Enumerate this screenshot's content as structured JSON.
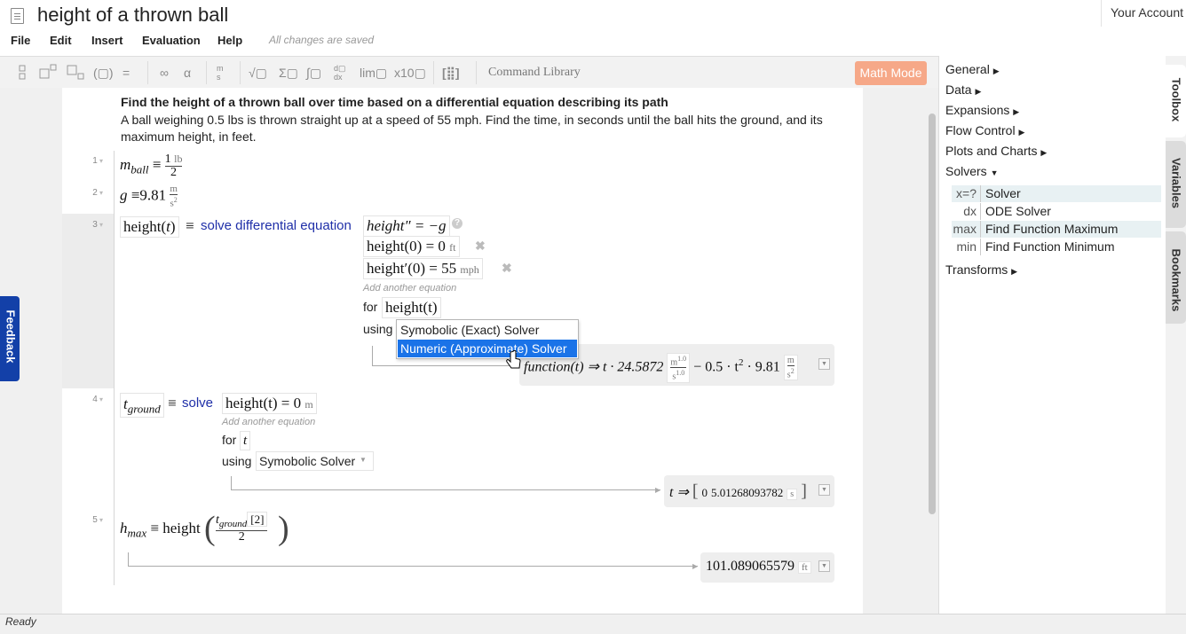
{
  "document": {
    "title": "height of a thrown ball",
    "save_status": "All changes are saved"
  },
  "account": {
    "label": "Your Account"
  },
  "menu": {
    "file": "File",
    "edit": "Edit",
    "insert": "Insert",
    "evaluation": "Evaluation",
    "help": "Help"
  },
  "toolbar": {
    "command_library": "Command Library",
    "math_mode": "Math Mode",
    "buttons": [
      "matrix-icon",
      "subscript-icon",
      "superscript-icon",
      "paren-icon",
      "equals-icon",
      "infinity-icon",
      "alpha-icon",
      "units-icon",
      "sqrt-icon",
      "sum-icon",
      "integral-icon",
      "derivative-icon",
      "limit-icon",
      "scientific-icon",
      "matrix-grid-icon"
    ]
  },
  "feedback": {
    "label": "Feedback"
  },
  "worksheet": {
    "intro_heading": "Find the height of a thrown ball over time based on a differential equation describing its path",
    "intro_text": "A ball weighing 0.5 lbs is thrown straight up at a speed of 55 mph.  Find the time, in seconds until the ball hits the ground, and its maximum height, in feet.",
    "line1": {
      "num": "1",
      "var": "m",
      "sub": "ball",
      "op": "≡",
      "num_val": "1",
      "unit": "lb",
      "den": "2"
    },
    "line2": {
      "num": "2",
      "var": "g",
      "op": "≡",
      "value": "9.81",
      "unit_num": "m",
      "unit_den": "s",
      "unit_den_pow": "2"
    },
    "line3": {
      "num": "3",
      "lhs": "height(",
      "lhs_var": "t",
      "lhs_close": ")",
      "op": "≡",
      "command": "solve differential equation",
      "eq1": "height″ = −g",
      "eq2": "height(0) = 0",
      "eq2_unit": "ft",
      "eq3": "height′(0) = 55",
      "eq3_unit": "mph",
      "add_eq": "Add another equation",
      "for_label": "for",
      "for_value": "height(t)",
      "using_label": "using",
      "solver_options": [
        "Symobolic (Exact) Solver",
        "Numeric (Approximate) Solver"
      ],
      "selected_option": "Numeric (Approximate) Solver",
      "result_fn": "function(t) ⇒ t · 24.5872",
      "result_unit_num": "m",
      "result_unit_num_pow": "1.0",
      "result_unit_den": "s",
      "result_unit_den_pow": "1.0",
      "result_mid": "− 0.5 · t",
      "result_pow": "2",
      "result_end": "· 9.81",
      "result_unit2_num": "m",
      "result_unit2_den": "s",
      "result_unit2_den_pow": "2"
    },
    "line4": {
      "num": "4",
      "var": "t",
      "sub": "ground",
      "op": "≡",
      "command": "solve",
      "eq": "height(t) = 0",
      "eq_unit": "m",
      "add_eq": "Add another equation",
      "for_label": "for",
      "for_value": "t",
      "using_label": "using",
      "solver_value": "Symobolic Solver",
      "result_var": "t ⇒",
      "result_open": "[",
      "result_v1": "0",
      "result_v2": "5.01268093782",
      "result_unit": "s",
      "result_close": "]"
    },
    "line5": {
      "num": "5",
      "var": "h",
      "sub": "max",
      "op": "≡ height",
      "frac_num_var": "t",
      "frac_num_sub": "ground",
      "frac_num_idx": "[2]",
      "frac_den": "2",
      "result": "101.089065579",
      "result_unit": "ft"
    }
  },
  "toolbox": {
    "categories": {
      "general": "General",
      "data": "Data",
      "expansions": "Expansions",
      "flow_control": "Flow Control",
      "plots_charts": "Plots and Charts",
      "solvers": "Solvers",
      "transforms": "Transforms"
    },
    "solver_items": [
      {
        "sym": "x=?",
        "label": "Solver"
      },
      {
        "sym": "dx",
        "label": "ODE Solver"
      },
      {
        "sym": "max",
        "label": "Find Function Maximum"
      },
      {
        "sym": "min",
        "label": "Find Function Minimum"
      }
    ]
  },
  "side_tabs": {
    "toolbox": "Toolbox",
    "variables": "Variables",
    "bookmarks": "Bookmarks"
  },
  "status": {
    "text": "Ready"
  }
}
